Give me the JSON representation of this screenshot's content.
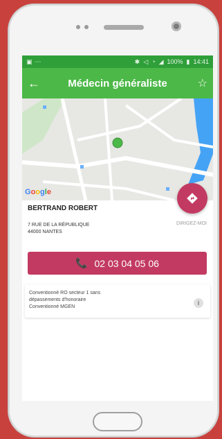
{
  "status_bar": {
    "battery": "100%",
    "time": "14:41"
  },
  "app_bar": {
    "title": "Médecin généraliste"
  },
  "map": {
    "logo_letters": [
      "G",
      "o",
      "o",
      "g",
      "l",
      "e"
    ]
  },
  "doctor": {
    "name": "BERTRAND ROBERT",
    "address_line1": "7 RUE DE LA RÉPUBLIQUE",
    "address_line2": "44000 NANTES"
  },
  "directions": {
    "label": "DIRIGEZ-MOI"
  },
  "call_button": {
    "phone": "02 03 04 05 06"
  },
  "info_card": {
    "line1": "Conventionné RO secteur 1 sans",
    "line2": "dépassements d'honoraire",
    "line3": "Conventionné MGEN"
  },
  "colors": {
    "status_bar": "#2f9f39",
    "app_bar": "#4cb848",
    "accent": "#c23a62",
    "background": "#c9413d"
  }
}
